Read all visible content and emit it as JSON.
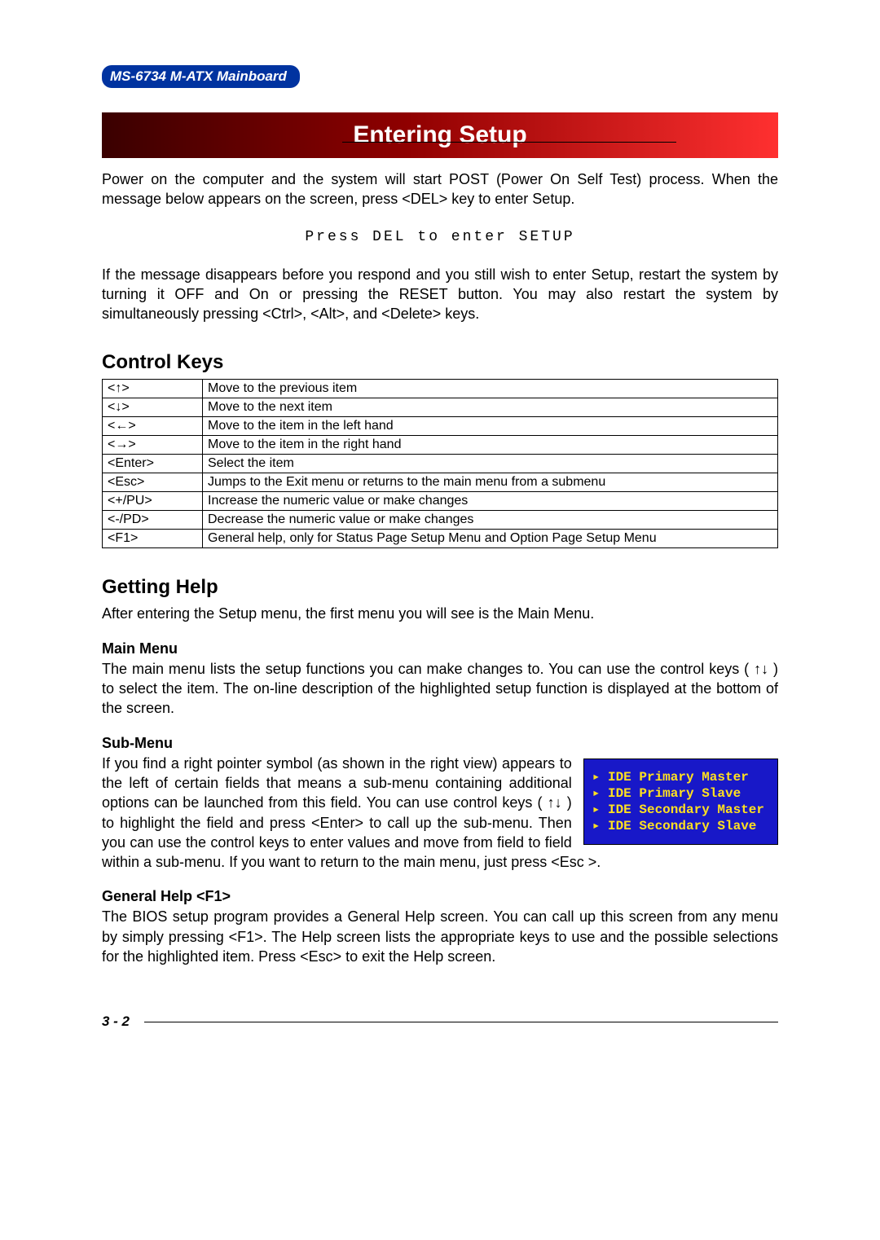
{
  "header": {
    "product": "MS-6734 M-ATX Mainboard"
  },
  "banner": {
    "title": "Entering Setup"
  },
  "intro": {
    "p1": "Power on the computer and the system will start POST (Power On Self Test) process. When the message below appears on the screen, press <DEL> key to enter Setup.",
    "mono": "Press DEL to enter SETUP",
    "p2": "If the message disappears before you respond and you still wish to enter Setup, restart the system by turning it OFF and On or pressing the RESET button. You may also restart the system by simultaneously pressing <Ctrl>, <Alt>, and <Delete> keys."
  },
  "control_keys": {
    "heading": "Control Keys",
    "rows": [
      {
        "key": "<↑>",
        "desc": "Move to the previous item"
      },
      {
        "key": "<↓>",
        "desc": "Move to the next item"
      },
      {
        "key": "<←>",
        "desc": "Move to the item in the left hand"
      },
      {
        "key": "<→>",
        "desc": "Move to the item in the right hand"
      },
      {
        "key": "<Enter>",
        "desc": "Select the item"
      },
      {
        "key": "<Esc>",
        "desc": "Jumps to the Exit menu or returns to the main menu from a submenu"
      },
      {
        "key": "<+/PU>",
        "desc": "Increase the numeric value or make changes"
      },
      {
        "key": "<-/PD>",
        "desc": "Decrease the numeric value or make changes"
      },
      {
        "key": "<F1>",
        "desc": "General help, only for Status Page Setup Menu and Option Page Setup Menu"
      }
    ]
  },
  "getting_help": {
    "heading": "Getting Help",
    "intro": "After entering the Setup menu, the first menu you will see is the Main Menu.",
    "main_menu": {
      "heading": "Main Menu",
      "text": "The main menu lists the setup functions you can make changes to. You can use the control keys ( ↑↓ ) to select the item. The on-line description of the highlighted setup function is displayed at the bottom of the screen."
    },
    "sub_menu": {
      "heading": "Sub-Menu",
      "text": "If you find a right pointer symbol (as shown in the right view) appears to the left of certain fields that means a sub-menu containing additional options can be launched from this field. You can use control keys ( ↑↓ ) to highlight the field and press <Enter> to call up the sub-menu. Then you can use the control keys to enter values and  move from field to field within a sub-menu. If you want to return to the main menu, just press <Esc >.",
      "bios_items": [
        "IDE Primary Master",
        "IDE Primary Slave",
        "IDE Secondary Master",
        "IDE Secondary Slave"
      ]
    },
    "general_help": {
      "heading": "General Help <F1>",
      "text": "The BIOS setup program provides a General  Help screen. You can call up this screen from any menu by simply pressing <F1>. The Help screen lists the appropriate keys to use and the possible selections for the highlighted item.  Press <Esc> to exit the Help screen."
    }
  },
  "footer": {
    "page": "3 - 2"
  }
}
